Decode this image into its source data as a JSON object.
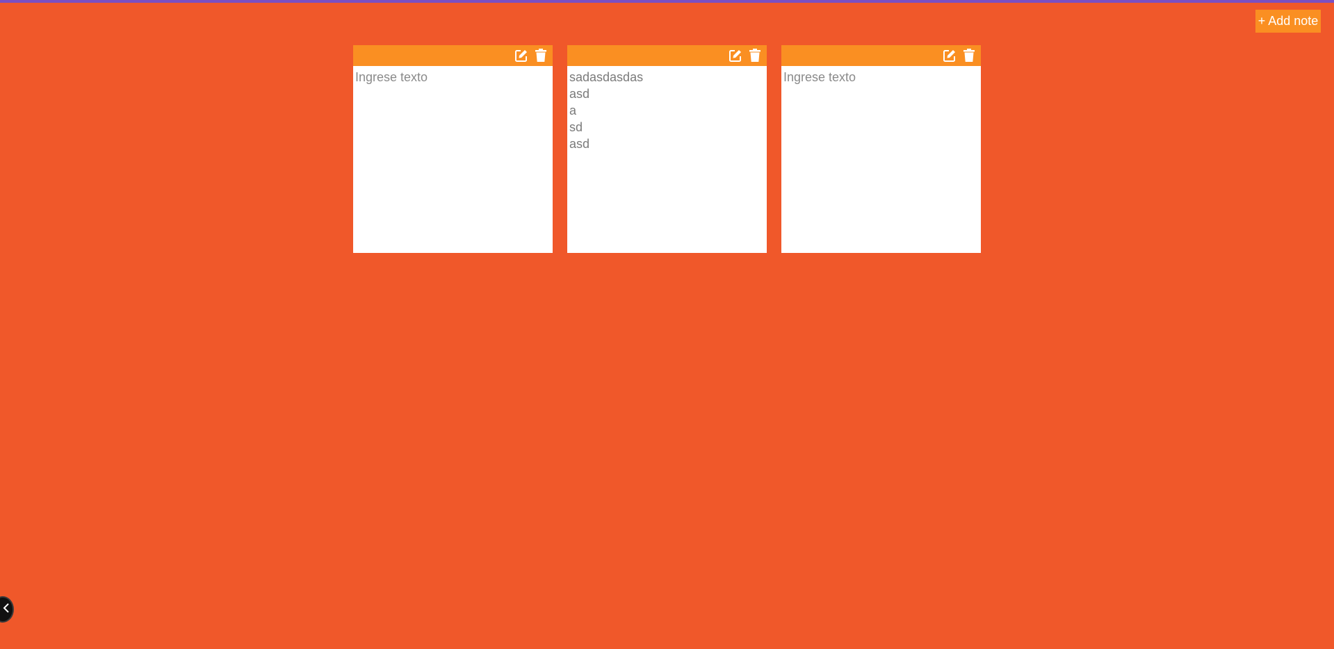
{
  "colors": {
    "background": "#F0582A",
    "accent_bar": "#7B4FC2",
    "note_header": "#FA8F22",
    "note_body": "#FFFFFF",
    "note_text": "#7A7A7A"
  },
  "toolbar": {
    "add_note_label": "+ Add note"
  },
  "notes": [
    {
      "text": "",
      "placeholder": "Ingrese texto",
      "icons": [
        "edit-icon",
        "trash-icon"
      ]
    },
    {
      "text": "sadasdasdas\nasd\na\nsd\nasd",
      "placeholder": "Ingrese texto",
      "icons": [
        "edit-icon",
        "trash-icon"
      ]
    },
    {
      "text": "",
      "placeholder": "Ingrese texto",
      "icons": [
        "edit-icon",
        "trash-icon"
      ]
    }
  ],
  "corner_toggle": {
    "icon": "chevron-left-icon"
  }
}
